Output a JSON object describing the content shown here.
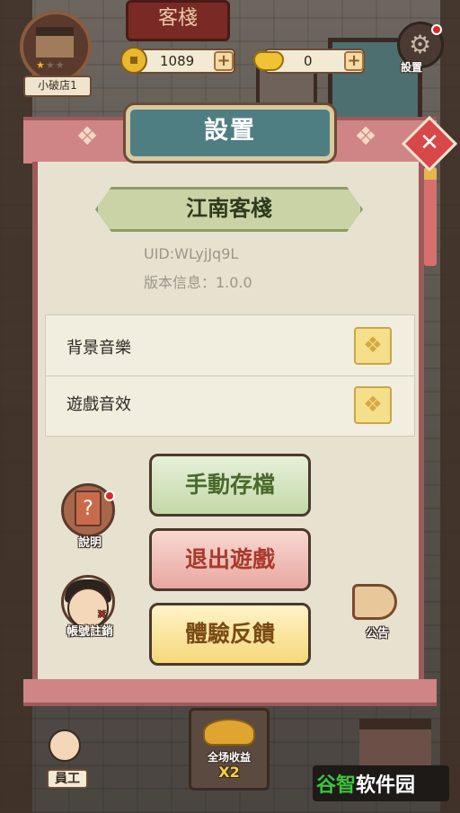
{
  "hud": {
    "shop_name": "小破店1",
    "stars": [
      "on",
      "off",
      "off"
    ],
    "coins": "1089",
    "ingots": "0",
    "plus": "+",
    "settings_label": "設置"
  },
  "background": {
    "sign_text": "客棧"
  },
  "dialog": {
    "title": "設置",
    "close_symbol": "✕",
    "inn_name": "江南客棧",
    "uid": "UID:WLyjJq9L",
    "version": "版本信息：1.0.0",
    "settings": [
      {
        "label": "背景音樂"
      },
      {
        "label": "遊戲音效"
      }
    ],
    "buttons": {
      "save": "手動存檔",
      "exit": "退出遊戲",
      "feedback": "體驗反饋"
    }
  },
  "side": {
    "help_label": "說明",
    "help_symbol": "?",
    "account_label": "帳號註銷",
    "notice_label": "公告"
  },
  "bottom": {
    "staff_label": "員工",
    "earn_title": "全场收益",
    "earn_mult": "X2"
  },
  "watermark": {
    "part1": "谷智",
    "part2": "软件园"
  },
  "colors": {
    "panel": "#e6e2cf",
    "frame": "#cf8585",
    "title_plate": "#4e7e82",
    "close": "#d84848"
  }
}
